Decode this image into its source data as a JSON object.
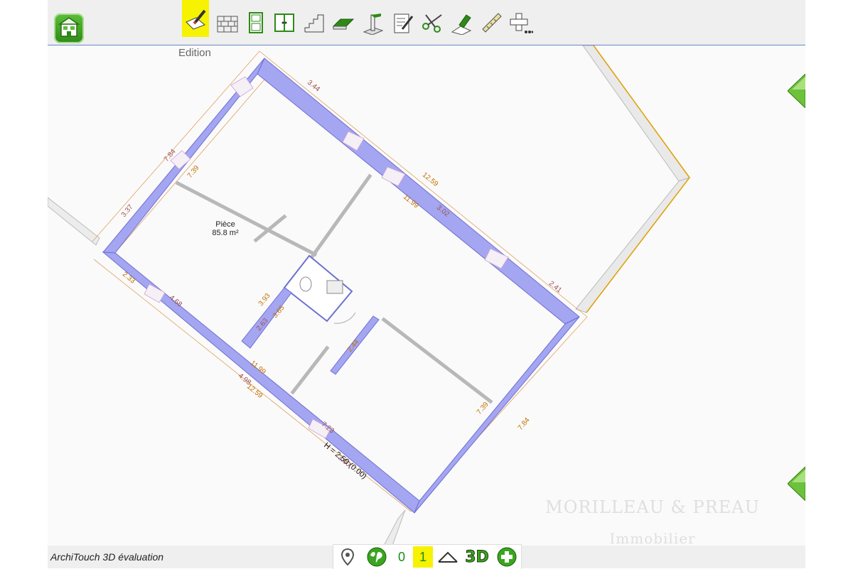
{
  "toolbar": {
    "mode_label": "Edition",
    "tools": [
      {
        "name": "draw-pencil-icon",
        "active": true
      },
      {
        "name": "brick-wall-icon",
        "active": false
      },
      {
        "name": "door-icon",
        "active": false
      },
      {
        "name": "window-icon",
        "active": false
      },
      {
        "name": "stairs-icon",
        "active": false
      },
      {
        "name": "floor-slab-icon",
        "active": false
      },
      {
        "name": "column-icon",
        "active": false
      },
      {
        "name": "note-edit-icon",
        "active": false
      },
      {
        "name": "scissors-icon",
        "active": false
      },
      {
        "name": "eraser-icon",
        "active": false
      },
      {
        "name": "ruler-icon",
        "active": false
      },
      {
        "name": "add-more-icon",
        "active": false
      }
    ]
  },
  "plan": {
    "room_name": "Pièce",
    "room_area": "85.8 m²",
    "height_label": "H = 2.50 (0.00)",
    "dimensions": [
      "3.44",
      "12.59",
      "3.02",
      "11.99",
      "2.41",
      "7.84",
      "7.39",
      "3.37",
      "2.33",
      "4.68",
      "4.98",
      "12.59",
      "11.99",
      "7.23",
      "3.00",
      "7.39",
      "7.84",
      "3.93",
      "3.65",
      "2.63",
      "2.44"
    ]
  },
  "footer": {
    "app_title": "ArchiTouch 3D évaluation",
    "levels": [
      "0",
      "1"
    ],
    "active_level": "1",
    "view_3d_label": "3D"
  },
  "watermark": {
    "line1": "MORILLEAU & PREAU",
    "line2": "Immobilier"
  },
  "colors": {
    "wall": "#a4a6f2",
    "dimension_line": "#e0a060",
    "accent_green": "#3aa51e",
    "active_highlight": "#f6f200"
  }
}
